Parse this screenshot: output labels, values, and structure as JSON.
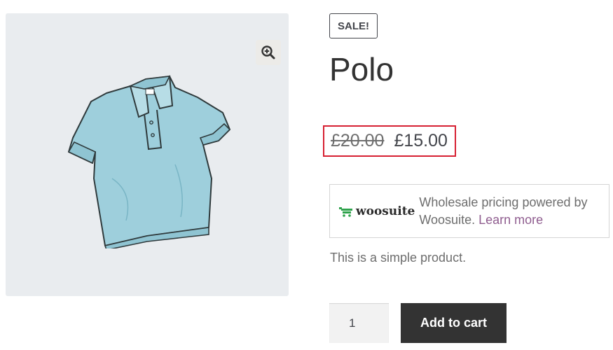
{
  "product": {
    "sale_badge": "SALE!",
    "title": "Polo",
    "price_original": "£20.00",
    "price_sale": "£15.00",
    "description": "This is a simple product."
  },
  "gallery": {
    "zoom_icon": "magnifier-plus-icon",
    "image_icon": "polo-shirt-image"
  },
  "wholesale": {
    "logo_text": "woosuite",
    "text": "Wholesale pricing powered by Woosuite.",
    "link_label": "Learn more"
  },
  "cart": {
    "quantity": "1",
    "add_label": "Add to cart"
  },
  "colors": {
    "highlight_border": "#d72032",
    "button_bg": "#333333",
    "link": "#8f5d8f",
    "logo_green": "#2ea24b"
  }
}
